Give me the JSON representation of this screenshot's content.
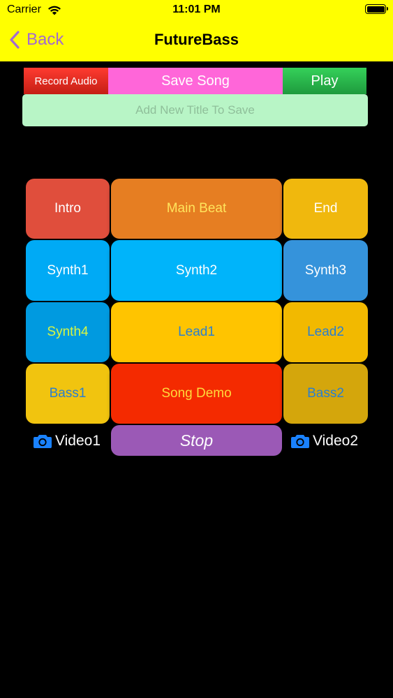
{
  "status_bar": {
    "carrier": "Carrier",
    "time": "11:01 PM"
  },
  "nav": {
    "back_label": "Back",
    "title": "FutureBass",
    "background_color": "#ffff00",
    "back_color": "#a36ad0"
  },
  "toolbar": {
    "record_label": "Record Audio",
    "save_label": "Save Song",
    "play_label": "Play",
    "title_placeholder": "Add New Title To Save",
    "title_value": ""
  },
  "pads": [
    {
      "label": "Intro",
      "bg": "#e04e3c",
      "fg": "#ffffff"
    },
    {
      "label": "Main Beat",
      "bg": "#e67e22",
      "fg": "#ffe45c"
    },
    {
      "label": "End",
      "bg": "#f0b80d",
      "fg": "#ffffff"
    },
    {
      "label": "Synth1",
      "bg": "#00aaf5",
      "fg": "#ffffff"
    },
    {
      "label": "Synth2",
      "bg": "#00b4fa",
      "fg": "#ffffff"
    },
    {
      "label": "Synth3",
      "bg": "#3593db",
      "fg": "#ffffff"
    },
    {
      "label": "Synth4",
      "bg": "#009ae0",
      "fg": "#d8f542"
    },
    {
      "label": "Lead1",
      "bg": "#ffc400",
      "fg": "#2a7fd0"
    },
    {
      "label": "Lead2",
      "bg": "#f2b900",
      "fg": "#2a7fd0"
    },
    {
      "label": "Bass1",
      "bg": "#f1c40f",
      "fg": "#2a7fd0"
    },
    {
      "label": "Song Demo",
      "bg": "#f42a00",
      "fg": "#ffd93b"
    },
    {
      "label": "Bass2",
      "bg": "#d4a60c",
      "fg": "#2a7fd0"
    }
  ],
  "bottom": {
    "video1_label": "Video1",
    "video2_label": "Video2",
    "stop_label": "Stop",
    "camera_color": "#1a82ff",
    "stop_color": "#9b59b6"
  },
  "icons": [
    "wifi-icon",
    "battery-icon",
    "chevron-left-icon",
    "camera-icon"
  ]
}
